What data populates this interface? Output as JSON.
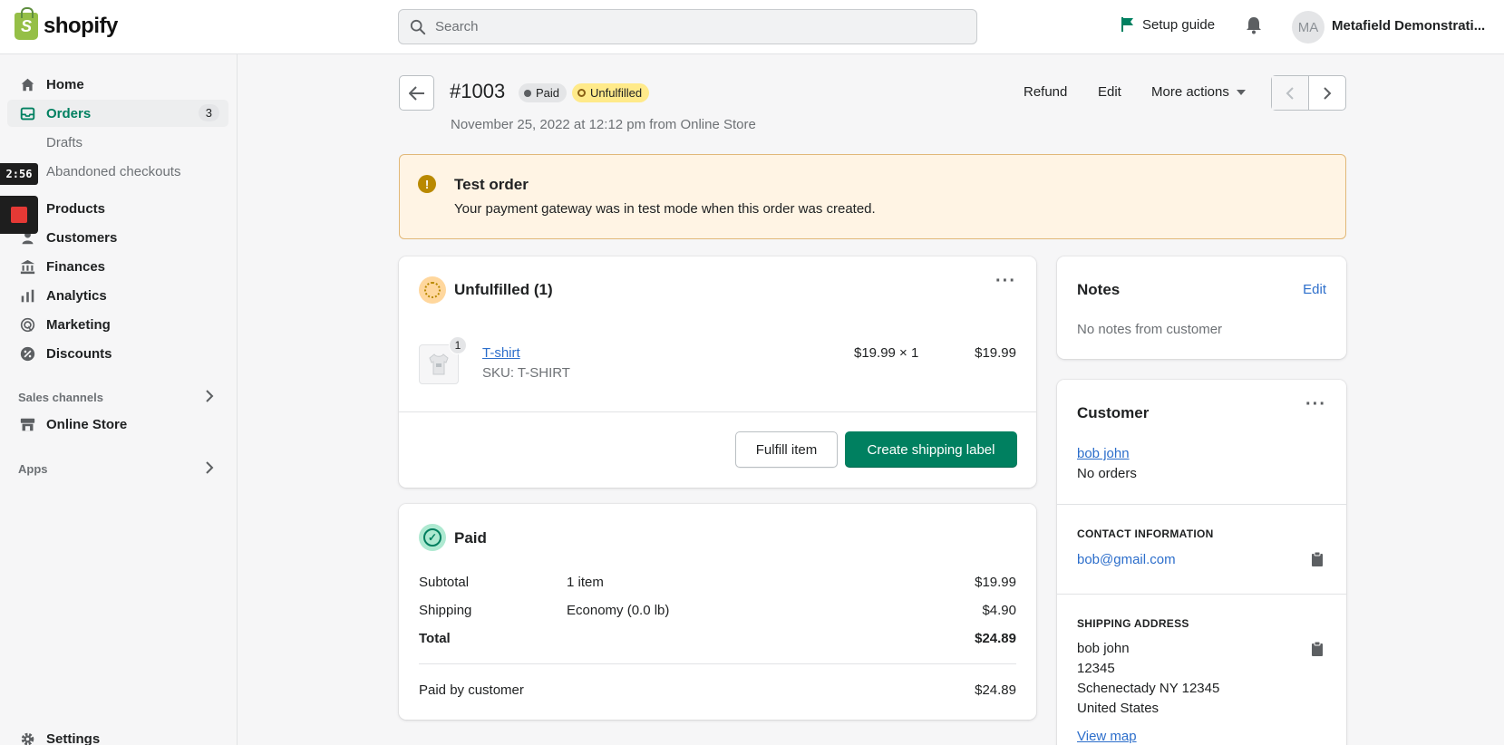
{
  "brand": {
    "name": "shopify",
    "accent": "#008060"
  },
  "topbar": {
    "search_placeholder": "Search",
    "setup_guide": "Setup guide",
    "avatar_initials": "MA",
    "store_name": "Metafield Demonstrati..."
  },
  "sidebar": {
    "items": [
      {
        "label": "Home",
        "icon": "home-icon"
      },
      {
        "label": "Orders",
        "icon": "orders-icon",
        "badge": "3",
        "active": true
      },
      {
        "label": "Drafts",
        "sub": true
      },
      {
        "label": "Abandoned checkouts",
        "sub": true
      },
      {
        "label": "Products",
        "icon": "tag-icon"
      },
      {
        "label": "Customers",
        "icon": "person-icon"
      },
      {
        "label": "Finances",
        "icon": "bank-icon"
      },
      {
        "label": "Analytics",
        "icon": "analytics-icon"
      },
      {
        "label": "Marketing",
        "icon": "target-icon"
      },
      {
        "label": "Discounts",
        "icon": "discount-icon"
      }
    ],
    "sales_channels_label": "Sales channels",
    "online_store": "Online Store",
    "apps_label": "Apps",
    "settings": "Settings"
  },
  "recorder": {
    "timer": "2:56"
  },
  "order": {
    "number": "#1003",
    "payment_badge": "Paid",
    "fulfillment_badge": "Unfulfilled",
    "date": "November 25, 2022 at 12:12 pm from Online Store",
    "actions": {
      "refund": "Refund",
      "edit": "Edit",
      "more": "More actions"
    }
  },
  "banner": {
    "title": "Test order",
    "text": "Your payment gateway was in test mode when this order was created."
  },
  "unfulfilled": {
    "title": "Unfulfilled (1)",
    "item": {
      "qty_badge": "1",
      "name": "T-shirt",
      "sku": "SKU: T-SHIRT",
      "price_qty": "$19.99 × 1",
      "total": "$19.99"
    },
    "fulfill_button": "Fulfill item",
    "shipping_label_button": "Create shipping label"
  },
  "paid": {
    "title": "Paid",
    "rows": [
      {
        "label": "Subtotal",
        "detail": "1 item",
        "amount": "$19.99"
      },
      {
        "label": "Shipping",
        "detail": "Economy (0.0 lb)",
        "amount": "$4.90"
      },
      {
        "label": "Total",
        "detail": "",
        "amount": "$24.89"
      }
    ],
    "paid_by_label": "Paid by customer",
    "paid_by_amount": "$24.89"
  },
  "notes": {
    "title": "Notes",
    "edit": "Edit",
    "empty": "No notes from customer"
  },
  "customer": {
    "title": "Customer",
    "name": "bob john",
    "orders": "No orders",
    "contact_heading": "CONTACT INFORMATION",
    "email": "bob@gmail.com",
    "shipping_heading": "SHIPPING ADDRESS",
    "address": [
      "bob john",
      "12345",
      "Schenectady NY 12345",
      "United States"
    ],
    "view_map": "View map"
  }
}
